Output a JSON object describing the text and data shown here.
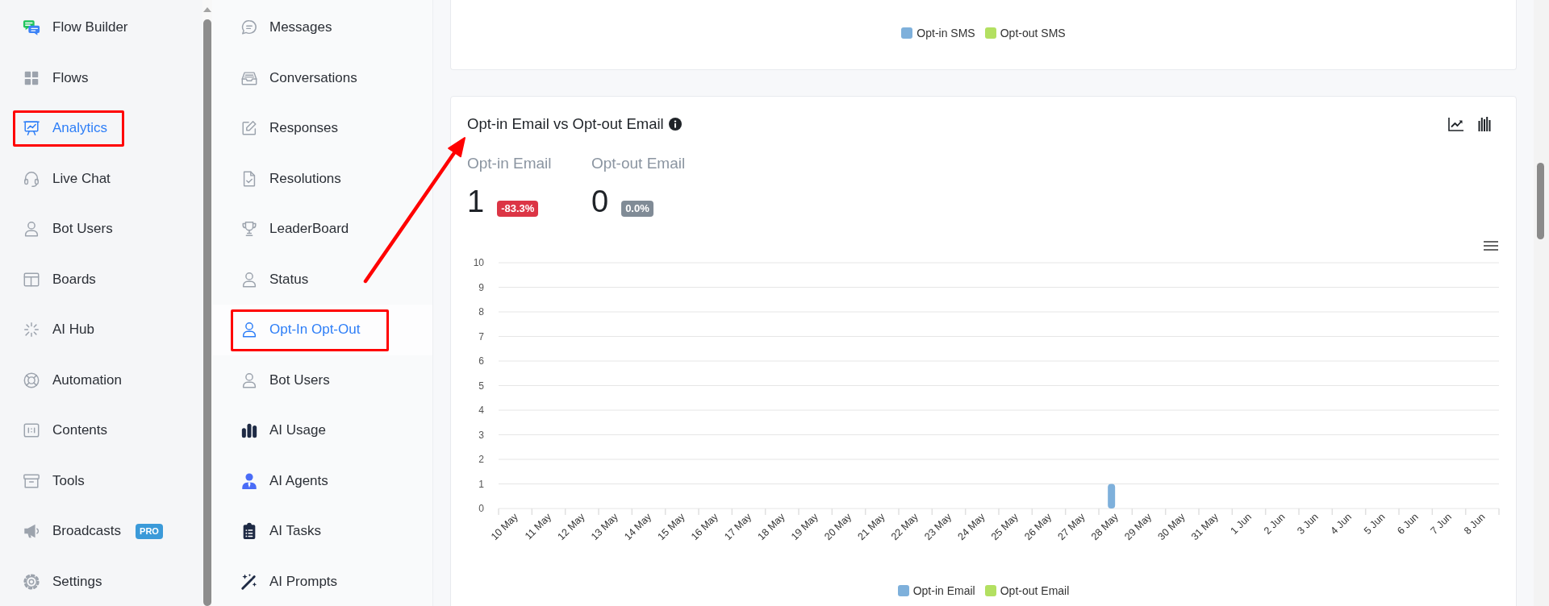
{
  "nav": {
    "items": [
      {
        "label": "Flow Builder",
        "selected": false,
        "highlighted": false
      },
      {
        "label": "Flows",
        "selected": false,
        "highlighted": false
      },
      {
        "label": "Analytics",
        "selected": true,
        "highlighted": true
      },
      {
        "label": "Live Chat",
        "selected": false,
        "highlighted": false
      },
      {
        "label": "Bot Users",
        "selected": false,
        "highlighted": false
      },
      {
        "label": "Boards",
        "selected": false,
        "highlighted": false
      },
      {
        "label": "AI Hub",
        "selected": false,
        "highlighted": false
      },
      {
        "label": "Automation",
        "selected": false,
        "highlighted": false
      },
      {
        "label": "Contents",
        "selected": false,
        "highlighted": false
      },
      {
        "label": "Tools",
        "selected": false,
        "highlighted": false
      },
      {
        "label": "Broadcasts",
        "selected": false,
        "highlighted": false,
        "badge": "PRO"
      },
      {
        "label": "Settings",
        "selected": false,
        "highlighted": false
      }
    ]
  },
  "subnav": {
    "items": [
      {
        "label": "Messages",
        "selected": false,
        "highlighted": false
      },
      {
        "label": "Conversations",
        "selected": false,
        "highlighted": false
      },
      {
        "label": "Responses",
        "selected": false,
        "highlighted": false
      },
      {
        "label": "Resolutions",
        "selected": false,
        "highlighted": false
      },
      {
        "label": "LeaderBoard",
        "selected": false,
        "highlighted": false
      },
      {
        "label": "Status",
        "selected": false,
        "highlighted": false
      },
      {
        "label": "Opt-In Opt-Out",
        "selected": true,
        "highlighted": true
      },
      {
        "label": "Bot Users",
        "selected": false,
        "highlighted": false
      },
      {
        "label": "AI Usage",
        "selected": false,
        "highlighted": false
      },
      {
        "label": "AI Agents",
        "selected": false,
        "highlighted": false
      },
      {
        "label": "AI Tasks",
        "selected": false,
        "highlighted": false
      },
      {
        "label": "AI Prompts",
        "selected": false,
        "highlighted": false
      }
    ]
  },
  "sms_card": {
    "legend": [
      {
        "label": "Opt-in SMS",
        "color": "#7eb0db"
      },
      {
        "label": "Opt-out SMS",
        "color": "#b3e061"
      }
    ]
  },
  "email_card": {
    "title": "Opt-in Email vs Opt-out Email",
    "stats": [
      {
        "label": "Opt-in Email",
        "value": "1",
        "change": "-83.3%",
        "color": "#dc3545"
      },
      {
        "label": "Opt-out Email",
        "value": "0",
        "change": "0.0%",
        "color": "#808b96"
      }
    ],
    "chart_data": {
      "type": "bar",
      "categories": [
        "10 May",
        "11 May",
        "12 May",
        "13 May",
        "14 May",
        "15 May",
        "16 May",
        "17 May",
        "18 May",
        "19 May",
        "20 May",
        "21 May",
        "22 May",
        "23 May",
        "24 May",
        "25 May",
        "26 May",
        "27 May",
        "28 May",
        "29 May",
        "30 May",
        "31 May",
        "1 Jun",
        "2 Jun",
        "3 Jun",
        "4 Jun",
        "5 Jun",
        "6 Jun",
        "7 Jun",
        "8 Jun"
      ],
      "series": [
        {
          "name": "Opt-in Email",
          "color": "#7eb0db",
          "values": [
            0,
            0,
            0,
            0,
            0,
            0,
            0,
            0,
            0,
            0,
            0,
            0,
            0,
            0,
            0,
            0,
            0,
            0,
            1,
            0,
            0,
            0,
            0,
            0,
            0,
            0,
            0,
            0,
            0,
            0
          ]
        },
        {
          "name": "Opt-out Email",
          "color": "#b3e061",
          "values": [
            0,
            0,
            0,
            0,
            0,
            0,
            0,
            0,
            0,
            0,
            0,
            0,
            0,
            0,
            0,
            0,
            0,
            0,
            0,
            0,
            0,
            0,
            0,
            0,
            0,
            0,
            0,
            0,
            0,
            0
          ]
        }
      ],
      "ylim": [
        0,
        10
      ],
      "yticks": [
        0,
        1,
        2,
        3,
        4,
        5,
        6,
        7,
        8,
        9,
        10
      ],
      "grid": true
    }
  }
}
